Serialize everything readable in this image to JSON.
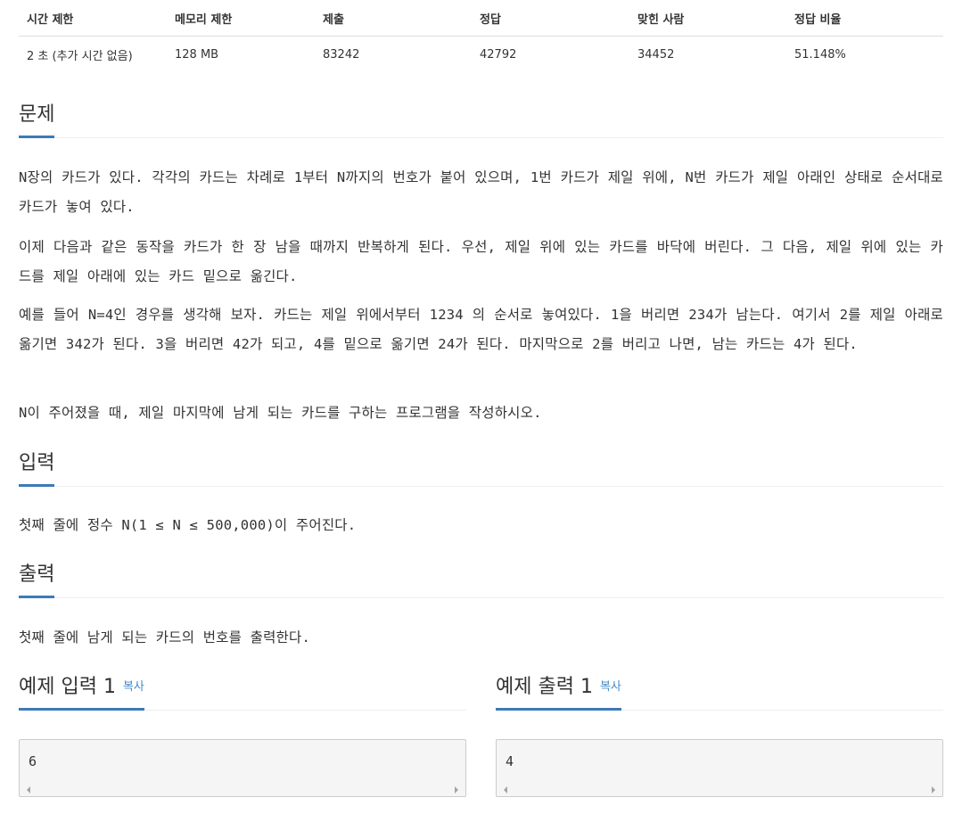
{
  "stats": {
    "headers": [
      "시간 제한",
      "메모리 제한",
      "제출",
      "정답",
      "맞힌 사람",
      "정답 비율"
    ],
    "values": [
      "2 초 (추가 시간 없음)",
      "128 MB",
      "83242",
      "42792",
      "34452",
      "51.148%"
    ]
  },
  "problem": {
    "title": "문제",
    "paragraphs": [
      "N장의 카드가 있다. 각각의 카드는 차례로 1부터 N까지의 번호가 붙어 있으며, 1번 카드가 제일 위에, N번 카드가 제일 아래인 상태로 순서대로 카드가 놓여 있다.",
      "이제 다음과 같은 동작을 카드가 한 장 남을 때까지 반복하게 된다. 우선, 제일 위에 있는 카드를 바닥에 버린다. 그 다음, 제일 위에 있는 카드를 제일 아래에 있는 카드 밑으로 옮긴다.",
      "예를 들어 N=4인 경우를 생각해 보자. 카드는 제일 위에서부터 1234 의 순서로 놓여있다. 1을 버리면 234가 남는다. 여기서 2를 제일 아래로 옮기면 342가 된다. 3을 버리면 42가 되고, 4를 밑으로 옮기면 24가 된다. 마지막으로 2를 버리고 나면, 남는 카드는 4가 된다.",
      "N이 주어졌을 때, 제일 마지막에 남게 되는 카드를 구하는 프로그램을 작성하시오."
    ]
  },
  "input": {
    "title": "입력",
    "text": "첫째 줄에 정수 N(1 ≤ N ≤ 500,000)이 주어진다."
  },
  "output": {
    "title": "출력",
    "text": "첫째 줄에 남게 되는 카드의 번호를 출력한다."
  },
  "samples": {
    "input_title": "예제 입력 1",
    "output_title": "예제 출력 1",
    "copy_label": "복사",
    "input_value": "6",
    "output_value": "4"
  },
  "colors": {
    "accent": "#3d7ab8",
    "link": "#428bca",
    "sample_bg": "#f5f5f5"
  }
}
